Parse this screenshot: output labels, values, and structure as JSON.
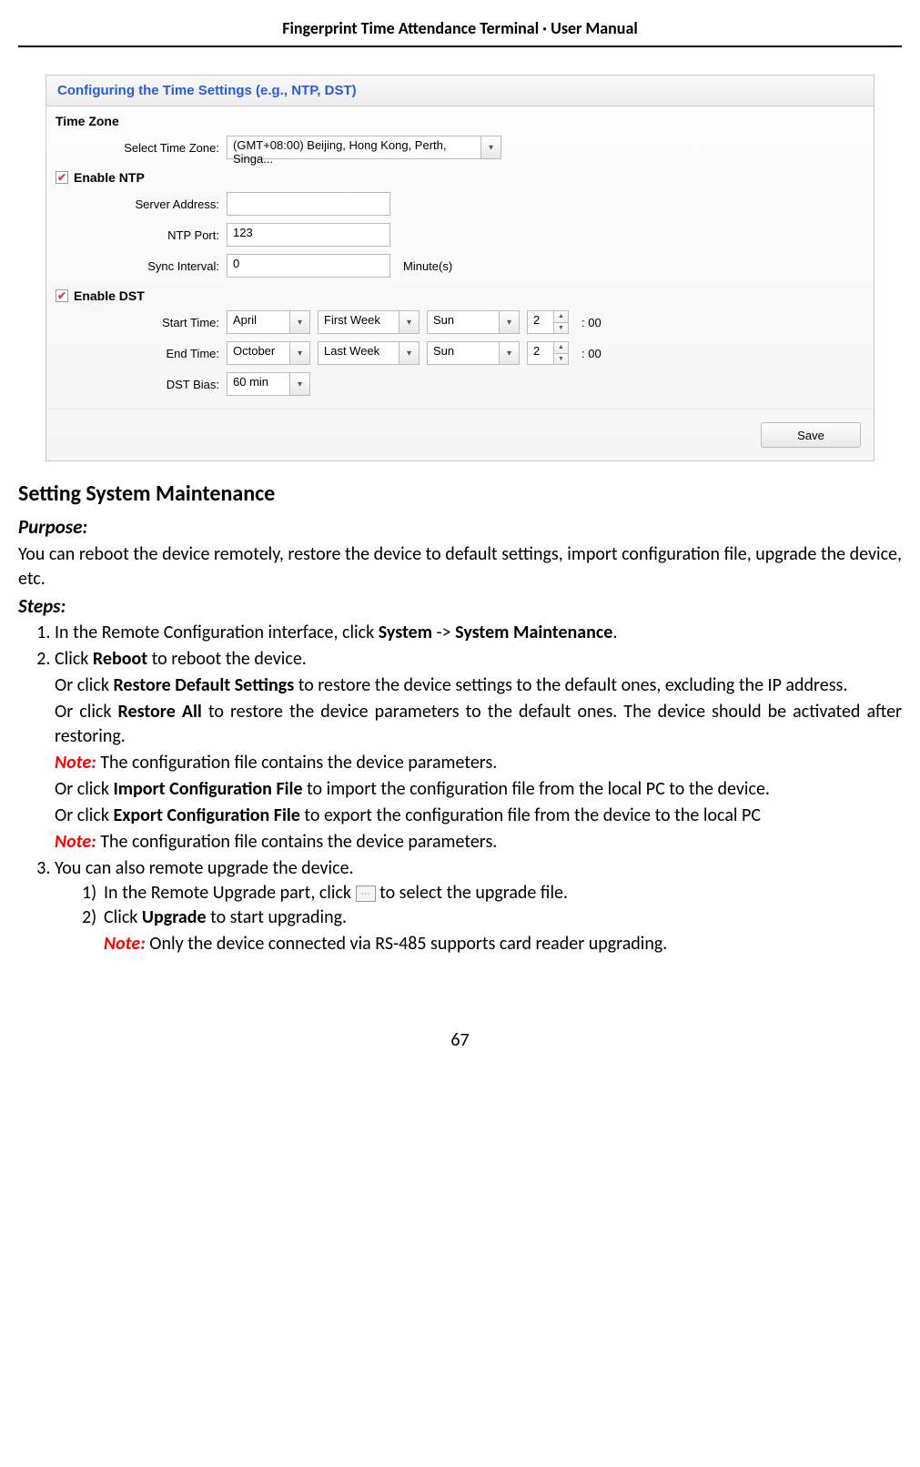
{
  "header": "Fingerprint Time Attendance Terminal · User Manual",
  "panel": {
    "title": "Configuring the Time Settings (e.g., NTP, DST)",
    "timezone_section": "Time Zone",
    "tz_label": "Select Time Zone:",
    "tz_value": "(GMT+08:00) Beijing, Hong Kong, Perth, Singa...",
    "ntp_section": "Enable NTP",
    "server_label": "Server Address:",
    "server_value": "",
    "port_label": "NTP Port:",
    "port_value": "123",
    "sync_label": "Sync Interval:",
    "sync_value": "0",
    "sync_suffix": "Minute(s)",
    "dst_section": "Enable DST",
    "start_label": "Start Time:",
    "start_month": "April",
    "start_week": "First Week",
    "start_day": "Sun",
    "start_hour": "2",
    "start_min": ": 00",
    "end_label": "End Time:",
    "end_month": "October",
    "end_week": "Last Week",
    "end_day": "Sun",
    "end_hour": "2",
    "end_min": ": 00",
    "bias_label": "DST Bias:",
    "bias_value": "60 min",
    "save": "Save"
  },
  "body": {
    "h2": "Setting System Maintenance",
    "purpose_label": "Purpose:",
    "purpose_text": "You can reboot the device remotely, restore the device to default settings, import configuration file, upgrade the device, etc.",
    "steps_label": "Steps:",
    "s1a": "In the Remote Configuration interface, click ",
    "s1b": "System",
    "s1c": " -> ",
    "s1d": "System Maintenance",
    "s1e": ".",
    "s2a": "Click ",
    "s2b": "Reboot",
    "s2c": " to reboot the device.",
    "s2d": "Or click ",
    "s2e": "Restore Default Settings",
    "s2f": " to restore the device settings to the default ones, excluding the IP address.",
    "s2g": "Or click ",
    "s2h": "Restore All",
    "s2i": " to restore the device parameters to the default ones. The device should be activated after restoring.",
    "note1": "Note:",
    "note1t": " The configuration file contains the device parameters.",
    "s2j": "Or click ",
    "s2k": "Import Configuration File",
    "s2l": " to import the configuration file from the local PC to the device.",
    "s2m": "Or click ",
    "s2n": "Export Configuration File",
    "s2o": " to export the configuration file from the device to the local PC",
    "note2": "Note:",
    "note2t": " The configuration file contains the device parameters.",
    "s3": "You can also remote upgrade the device.",
    "s3_1a": "In the Remote Upgrade part, click ",
    "s3_1b": " to select the upgrade file.",
    "s3_2a": "Click ",
    "s3_2b": "Upgrade",
    "s3_2c": " to start upgrading.",
    "note3": "Note:",
    "note3t": " Only the device connected via RS-485 supports card reader upgrading.",
    "browse_icon": "⋯"
  },
  "page_num": "67"
}
